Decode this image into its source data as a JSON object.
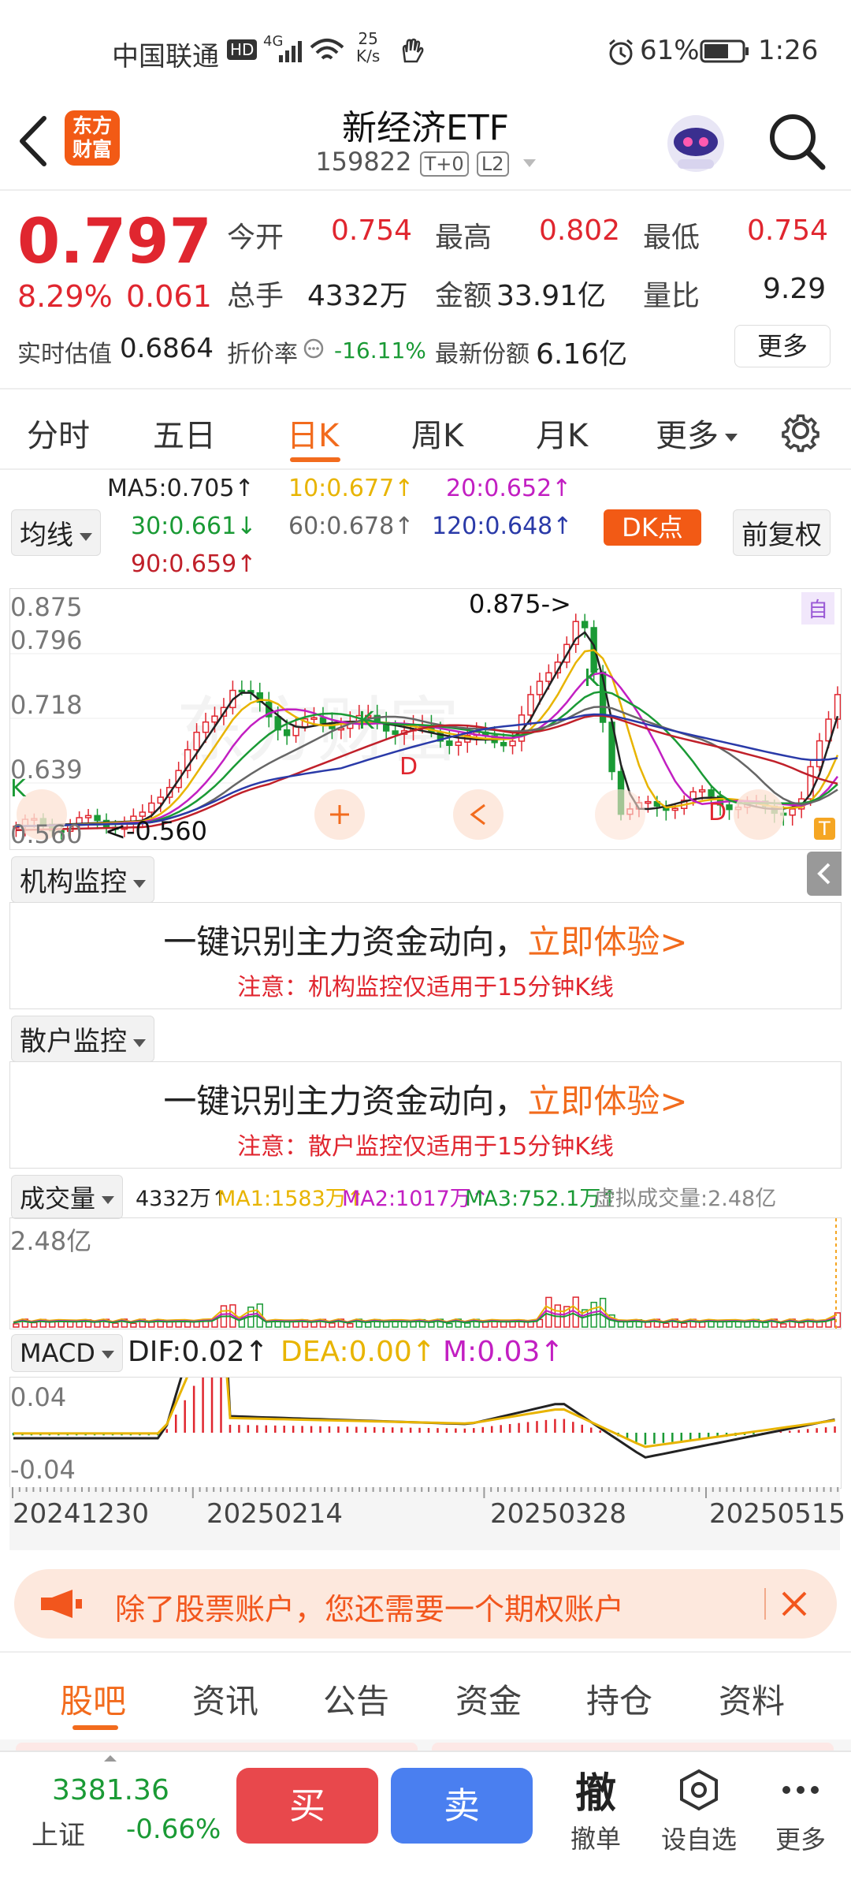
{
  "status_bar": {
    "carrier": "中国联通",
    "hd": "HD",
    "net_type": "4G",
    "speed_value": "25",
    "speed_unit": "K/s",
    "battery": "61%",
    "time": "1:26"
  },
  "header": {
    "logo_line1": "东方",
    "logo_line2": "财富",
    "title": "新经济ETF",
    "code": "159822",
    "badge_t0": "T+0",
    "badge_l2": "L2"
  },
  "quote": {
    "price": "0.797",
    "change_pct": "8.29%",
    "change_amt": "0.061",
    "open_label": "今开",
    "open_value": "0.754",
    "high_label": "最高",
    "high_value": "0.802",
    "low_label": "最低",
    "low_value": "0.754",
    "volume_label": "总手",
    "volume_value": "4332万",
    "amount_label": "金额",
    "amount_value": "33.91亿",
    "ratio_label": "量比",
    "ratio_value": "9.29",
    "est_label": "实时估值",
    "est_value": "0.6864",
    "discount_label": "折价率",
    "discount_value": "-16.11%",
    "shares_label": "最新份额",
    "shares_value": "6.16亿",
    "more_label": "更多"
  },
  "period_tabs": [
    "分时",
    "五日",
    "日K",
    "周K",
    "月K",
    "更多"
  ],
  "active_tab": 2,
  "ma_legend": {
    "dropdown": "均线",
    "ma5": "MA5:0.705↑",
    "ma10": "10:0.677↑",
    "ma20": "20:0.652↑",
    "ma30": "30:0.661↓",
    "ma60": "60:0.678↑",
    "ma120": "120:0.648↑",
    "ma90": "90:0.659↑",
    "dk_label": "DK点",
    "adjust_label": "前复权",
    "colors": {
      "ma5": "#222222",
      "ma10": "#e8b400",
      "ma20": "#c21fc2",
      "ma30": "#1a9a35",
      "ma60": "#666666",
      "ma120": "#2a3aa8",
      "ma90": "#c0202a"
    }
  },
  "kline": {
    "y_labels": [
      "0.875",
      "0.796",
      "0.718",
      "0.639",
      "0.560"
    ],
    "high_marker": "0.875->",
    "low_marker": "<-0.560",
    "auto_label": "自",
    "t_label": "T",
    "k_mark": "K",
    "d_mark": "D"
  },
  "inst_monitor": {
    "dropdown": "机构监控",
    "promo": "一键识别主力资金动向，",
    "cta": "立即体验>",
    "note": "注意：机构监控仅适用于15分钟K线"
  },
  "retail_monitor": {
    "dropdown": "散户监控",
    "promo": "一键识别主力资金动向，",
    "cta": "立即体验>",
    "note": "注意：散户监控仅适用于15分钟K线"
  },
  "volume": {
    "dropdown": "成交量",
    "vol": "4332万↑",
    "ma1": "MA1:1583万↑",
    "ma2": "MA2:1017万↑",
    "ma3": "MA3:752.1万↑",
    "virtual": "虚拟成交量:2.48亿",
    "axis_label": "2.48亿"
  },
  "macd": {
    "dropdown": "MACD",
    "dif": "DIF:0.02↑",
    "dea": "DEA:0.00↑",
    "m": "M:0.03↑",
    "y_top": "0.04",
    "y_bottom": "-0.04"
  },
  "dates": [
    "20241230",
    "20250214",
    "20250328",
    "20250515"
  ],
  "banner": {
    "text": "除了股票账户，您还需要一个期权账户"
  },
  "bottom_tabs": [
    "股吧",
    "资讯",
    "公告",
    "资金",
    "持仓",
    "资料"
  ],
  "bottom_active": 0,
  "footer": {
    "index_value": "3381.36",
    "index_name": "上证",
    "index_change": "-0.66%",
    "buy": "买",
    "sell": "卖",
    "withdraw_big": "撤",
    "withdraw_label": "撤单",
    "watch_label": "设自选",
    "more_label": "更多"
  },
  "colors": {
    "up": "#e0262f",
    "down": "#1a9a35",
    "accent": "#f26b1d",
    "buy": "#e8484c",
    "sell": "#4a7ff0"
  }
}
